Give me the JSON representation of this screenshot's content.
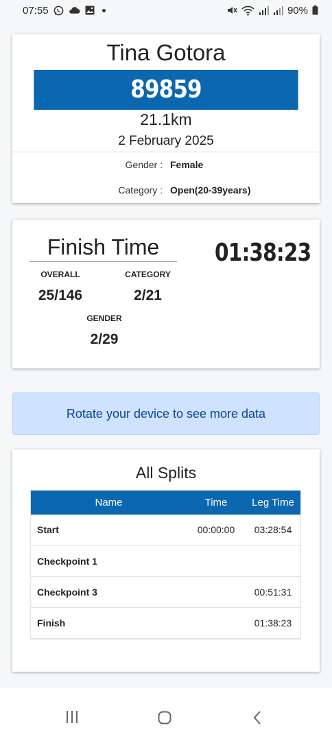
{
  "status_bar": {
    "time": "07:55",
    "battery": "90%",
    "left_icons": [
      "whatsapp-icon",
      "cloud-icon",
      "gallery-icon",
      "dot-icon"
    ],
    "right_icons": [
      "mute-icon",
      "wifi-icon",
      "signal-icon",
      "signal-icon",
      "battery-icon"
    ]
  },
  "athlete": {
    "name": "Tina Gotora",
    "bib": "89859",
    "distance": "21.1km",
    "date": "2 February 2025",
    "gender_label": "Gender :",
    "gender_value": "Female",
    "category_label": "Category :",
    "category_value": "Open(20-39years)"
  },
  "finish": {
    "title": "Finish Time",
    "time": "01:38:23",
    "overall_label": "OVERALL",
    "overall_value": "25/146",
    "category_label": "CATEGORY",
    "category_value": "2/21",
    "gender_label": "GENDER",
    "gender_value": "2/29"
  },
  "alert": {
    "text": "Rotate your device to see more data"
  },
  "splits": {
    "title": "All Splits",
    "columns": [
      "Name",
      "Time",
      "Leg Time"
    ],
    "rows": [
      {
        "name": "Start",
        "time": "00:00:00",
        "leg": "03:28:54"
      },
      {
        "name": "Checkpoint 1",
        "time": "",
        "leg": ""
      },
      {
        "name": "Checkpoint 3",
        "time": "",
        "leg": "00:51:31"
      },
      {
        "name": "Finish",
        "time": "",
        "leg": "01:38:23"
      }
    ]
  },
  "nav_bar": {
    "buttons": [
      "recent-apps-icon",
      "home-icon",
      "back-icon"
    ]
  },
  "colors": {
    "brand_blue": "#0b67b0",
    "alert_bg": "#cfe2ff",
    "alert_text": "#084298"
  }
}
